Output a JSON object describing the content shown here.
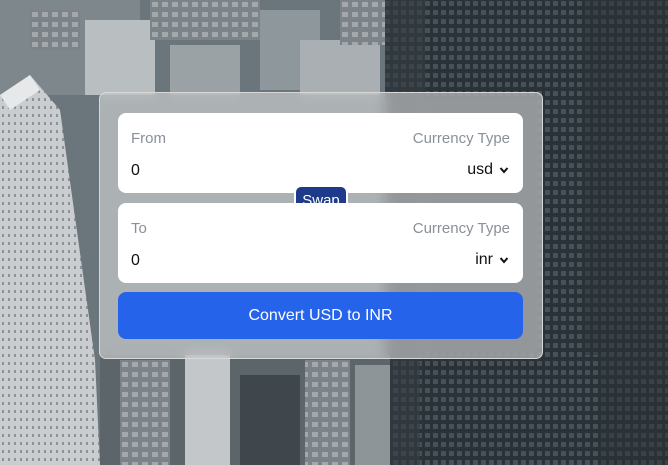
{
  "from": {
    "label": "From",
    "currency_type_label": "Currency Type",
    "amount": "0",
    "currency": "usd"
  },
  "swap_label": "Swap",
  "to": {
    "label": "To",
    "currency_type_label": "Currency Type",
    "amount": "0",
    "currency": "inr"
  },
  "convert_label": "Convert USD to INR",
  "colors": {
    "convert_button": "#2563eb",
    "swap_button": "#1e3a8a",
    "label_text": "#8a9099"
  }
}
